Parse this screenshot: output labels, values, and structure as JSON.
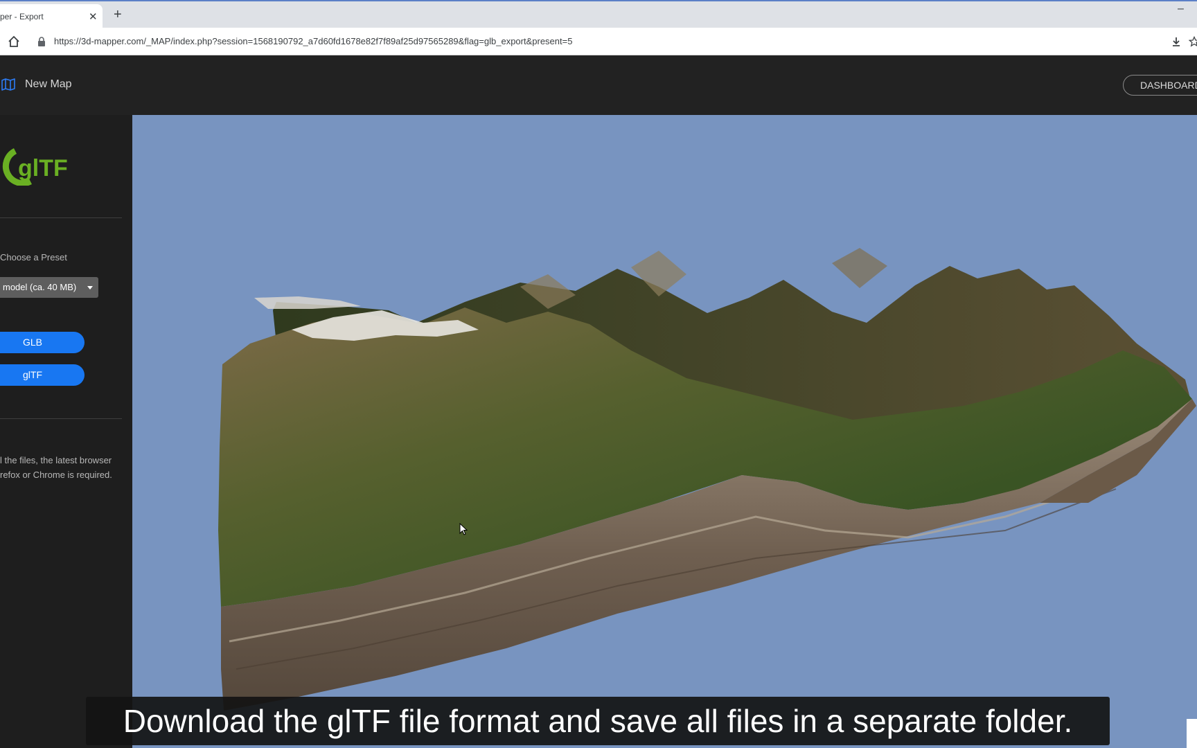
{
  "browser": {
    "tab_title": "per - Export",
    "close_glyph": "✕",
    "new_tab_glyph": "+",
    "minimize_glyph": "–",
    "url": "https://3d-mapper.com/_MAP/index.php?session=1568190792_a7d60fd1678e82f7f89af25d97565289&flag=glb_export&present=5"
  },
  "header": {
    "icon": "map-icon",
    "title": "New Map",
    "dashboard_label": "DASHBOARD"
  },
  "sidebar": {
    "logo_text": "glTF",
    "logo_color": "#6ab023",
    "preset_label": "Choose a Preset",
    "preset_value": "model (ca. 40 MB)",
    "buttons": {
      "glb": "GLB",
      "gltf": "glTF"
    },
    "info_lines": [
      "l the files, the latest browser",
      "refox or Chrome is required."
    ],
    "accent": "#1877f2"
  },
  "viewport": {
    "sky_color": "#7894c0"
  },
  "caption": "Download the glTF file format and save all files in a separate folder."
}
